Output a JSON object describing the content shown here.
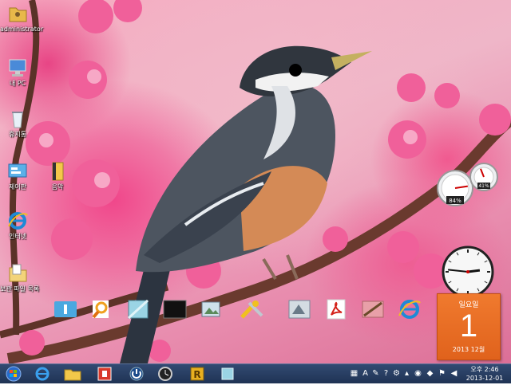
{
  "desktop": {
    "icons": [
      {
        "label": "administrator",
        "icon": "user-folder-icon"
      },
      {
        "label": "내 PC",
        "icon": "computer-icon"
      },
      {
        "label": "휴지통",
        "icon": "recycle-bin-icon"
      },
      {
        "label": "제어판",
        "icon": "control-panel-icon"
      },
      {
        "label": "음악",
        "icon": "music-library-icon"
      },
      {
        "label": "인터넷",
        "icon": "internet-explorer-icon"
      },
      {
        "label": "보관 파일 목록",
        "icon": "documents-folder-icon"
      }
    ]
  },
  "dock": {
    "items": [
      {
        "icon": "info-folder-icon",
        "color": "#4aa8e0"
      },
      {
        "icon": "magnifier-icon",
        "color": "#f0a020"
      },
      {
        "icon": "glass-window-icon",
        "color": "#7ac8d8"
      },
      {
        "icon": "black-screen-icon",
        "color": "#111111"
      },
      {
        "icon": "picture-viewer-icon",
        "color": "#9ab"
      },
      {
        "icon": "tools-icon",
        "color": "#f0c020"
      },
      {
        "icon": "scanner-icon",
        "color": "#b8c4cc"
      },
      {
        "icon": "acrobat-pdf-icon",
        "color": "#d4221a"
      },
      {
        "icon": "image-edit-icon",
        "color": "#c8a040"
      },
      {
        "icon": "internet-explorer-icon",
        "color": "#1e8ad6"
      }
    ]
  },
  "gadgets": {
    "meter": {
      "cpu_label": "84%",
      "ram_label": "41%",
      "cpu_level": 0.84,
      "ram_level": 0.41
    },
    "clock": {
      "hour": 2,
      "minute": 46
    },
    "calendar": {
      "weekday": "일요일",
      "day": "1",
      "month_year": "2013 12월"
    }
  },
  "taskbar": {
    "items": [
      {
        "icon": "start-orb-icon"
      },
      {
        "icon": "internet-explorer-icon"
      },
      {
        "icon": "file-explorer-icon"
      },
      {
        "icon": "media-app-icon"
      },
      {
        "icon": "power-icon"
      },
      {
        "icon": "clock-app-icon"
      },
      {
        "icon": "r-app-icon"
      },
      {
        "icon": "window-app-icon"
      }
    ],
    "tray": {
      "ime_mode": "A",
      "items": [
        "keyboard-icon",
        "ime-icon",
        "settings-icon",
        "help-icon",
        "up-arrow-icon",
        "network-icon",
        "shield-icon",
        "flag-icon",
        "volume-icon"
      ],
      "time": "오후 2:46",
      "date": "2013-12-01"
    }
  },
  "colors": {
    "taskbar": "#243a60",
    "calendar": "#e86a22",
    "ie_blue": "#1e8ad6"
  }
}
